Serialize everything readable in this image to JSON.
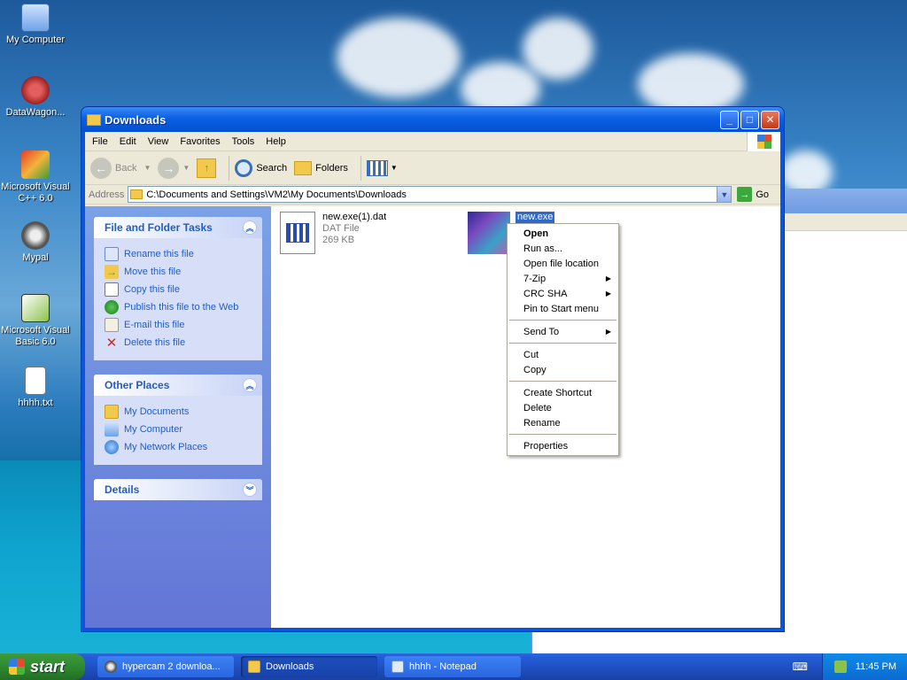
{
  "desktop": {
    "icons": [
      {
        "label": "My Computer",
        "icon": "my-computer-icon"
      },
      {
        "label": "DataWagon...",
        "icon": "datawagon-icon"
      },
      {
        "label": "Microsoft Visual C++ 6.0",
        "icon": "visual-cpp-icon"
      },
      {
        "label": "Mypal",
        "icon": "mypal-icon"
      },
      {
        "label": "Microsoft Visual Basic 6.0",
        "icon": "visual-basic-icon"
      },
      {
        "label": "hhhh.txt",
        "icon": "text-file-icon"
      }
    ]
  },
  "window": {
    "title": "Downloads",
    "menu": [
      "File",
      "Edit",
      "View",
      "Favorites",
      "Tools",
      "Help"
    ],
    "toolbar": {
      "back": "Back",
      "search": "Search",
      "folders": "Folders"
    },
    "address": {
      "label": "Address",
      "value": "C:\\Documents and Settings\\VM2\\My Documents\\Downloads",
      "go": "Go"
    },
    "file_tasks": {
      "title": "File and Folder Tasks",
      "items": [
        "Rename this file",
        "Move this file",
        "Copy this file",
        "Publish this file to the Web",
        "E-mail this file",
        "Delete this file"
      ]
    },
    "other_places": {
      "title": "Other Places",
      "items": [
        "My Documents",
        "My Computer",
        "My Network Places"
      ]
    },
    "details": {
      "title": "Details"
    },
    "files": [
      {
        "name": "new.exe(1).dat",
        "type": "DAT File",
        "size": "269 KB"
      },
      {
        "name": "new.exe"
      }
    ]
  },
  "context_menu": {
    "groups": [
      [
        "Open",
        "Run as...",
        "Open file location",
        "7-Zip",
        "CRC SHA",
        "Pin to Start menu"
      ],
      [
        "Send To"
      ],
      [
        "Cut",
        "Copy"
      ],
      [
        "Create Shortcut",
        "Delete",
        "Rename"
      ],
      [
        "Properties"
      ]
    ]
  },
  "taskbar": {
    "start": "start",
    "buttons": [
      "hypercam 2 downloa...",
      "Downloads",
      "hhhh - Notepad"
    ],
    "clock": "11:45 PM"
  },
  "colors": {
    "xp_blue": "#0a54e0",
    "link_blue": "#215dc6",
    "start_green": "#2f8a2f"
  }
}
